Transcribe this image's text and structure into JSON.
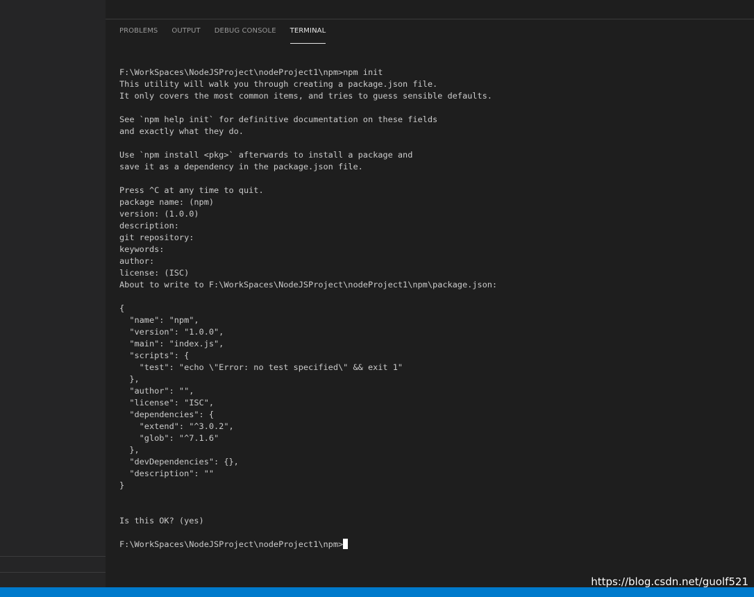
{
  "panel": {
    "tabs": [
      {
        "label": "PROBLEMS",
        "active": false
      },
      {
        "label": "OUTPUT",
        "active": false
      },
      {
        "label": "DEBUG CONSOLE",
        "active": false
      },
      {
        "label": "TERMINAL",
        "active": true
      }
    ]
  },
  "terminal": {
    "lines": [
      "F:\\WorkSpaces\\NodeJSProject\\nodeProject1\\npm>npm init",
      "This utility will walk you through creating a package.json file.",
      "It only covers the most common items, and tries to guess sensible defaults.",
      "",
      "See `npm help init` for definitive documentation on these fields",
      "and exactly what they do.",
      "",
      "Use `npm install <pkg>` afterwards to install a package and",
      "save it as a dependency in the package.json file.",
      "",
      "Press ^C at any time to quit.",
      "package name: (npm)",
      "version: (1.0.0)",
      "description:",
      "git repository:",
      "keywords:",
      "author:",
      "license: (ISC)",
      "About to write to F:\\WorkSpaces\\NodeJSProject\\nodeProject1\\npm\\package.json:",
      "",
      "{",
      "  \"name\": \"npm\",",
      "  \"version\": \"1.0.0\",",
      "  \"main\": \"index.js\",",
      "  \"scripts\": {",
      "    \"test\": \"echo \\\"Error: no test specified\\\" && exit 1\"",
      "  },",
      "  \"author\": \"\",",
      "  \"license\": \"ISC\",",
      "  \"dependencies\": {",
      "    \"extend\": \"^3.0.2\",",
      "    \"glob\": \"^7.1.6\"",
      "  },",
      "  \"devDependencies\": {},",
      "  \"description\": \"\"",
      "}",
      "",
      "",
      "Is this OK? (yes)",
      ""
    ],
    "prompt": "F:\\WorkSpaces\\NodeJSProject\\nodeProject1\\npm>"
  },
  "watermark": "https://blog.csdn.net/guolf521",
  "colors": {
    "background": "#1e1e1e",
    "sidebar": "#252526",
    "statusbar": "#007acc",
    "text": "#cccccc"
  }
}
